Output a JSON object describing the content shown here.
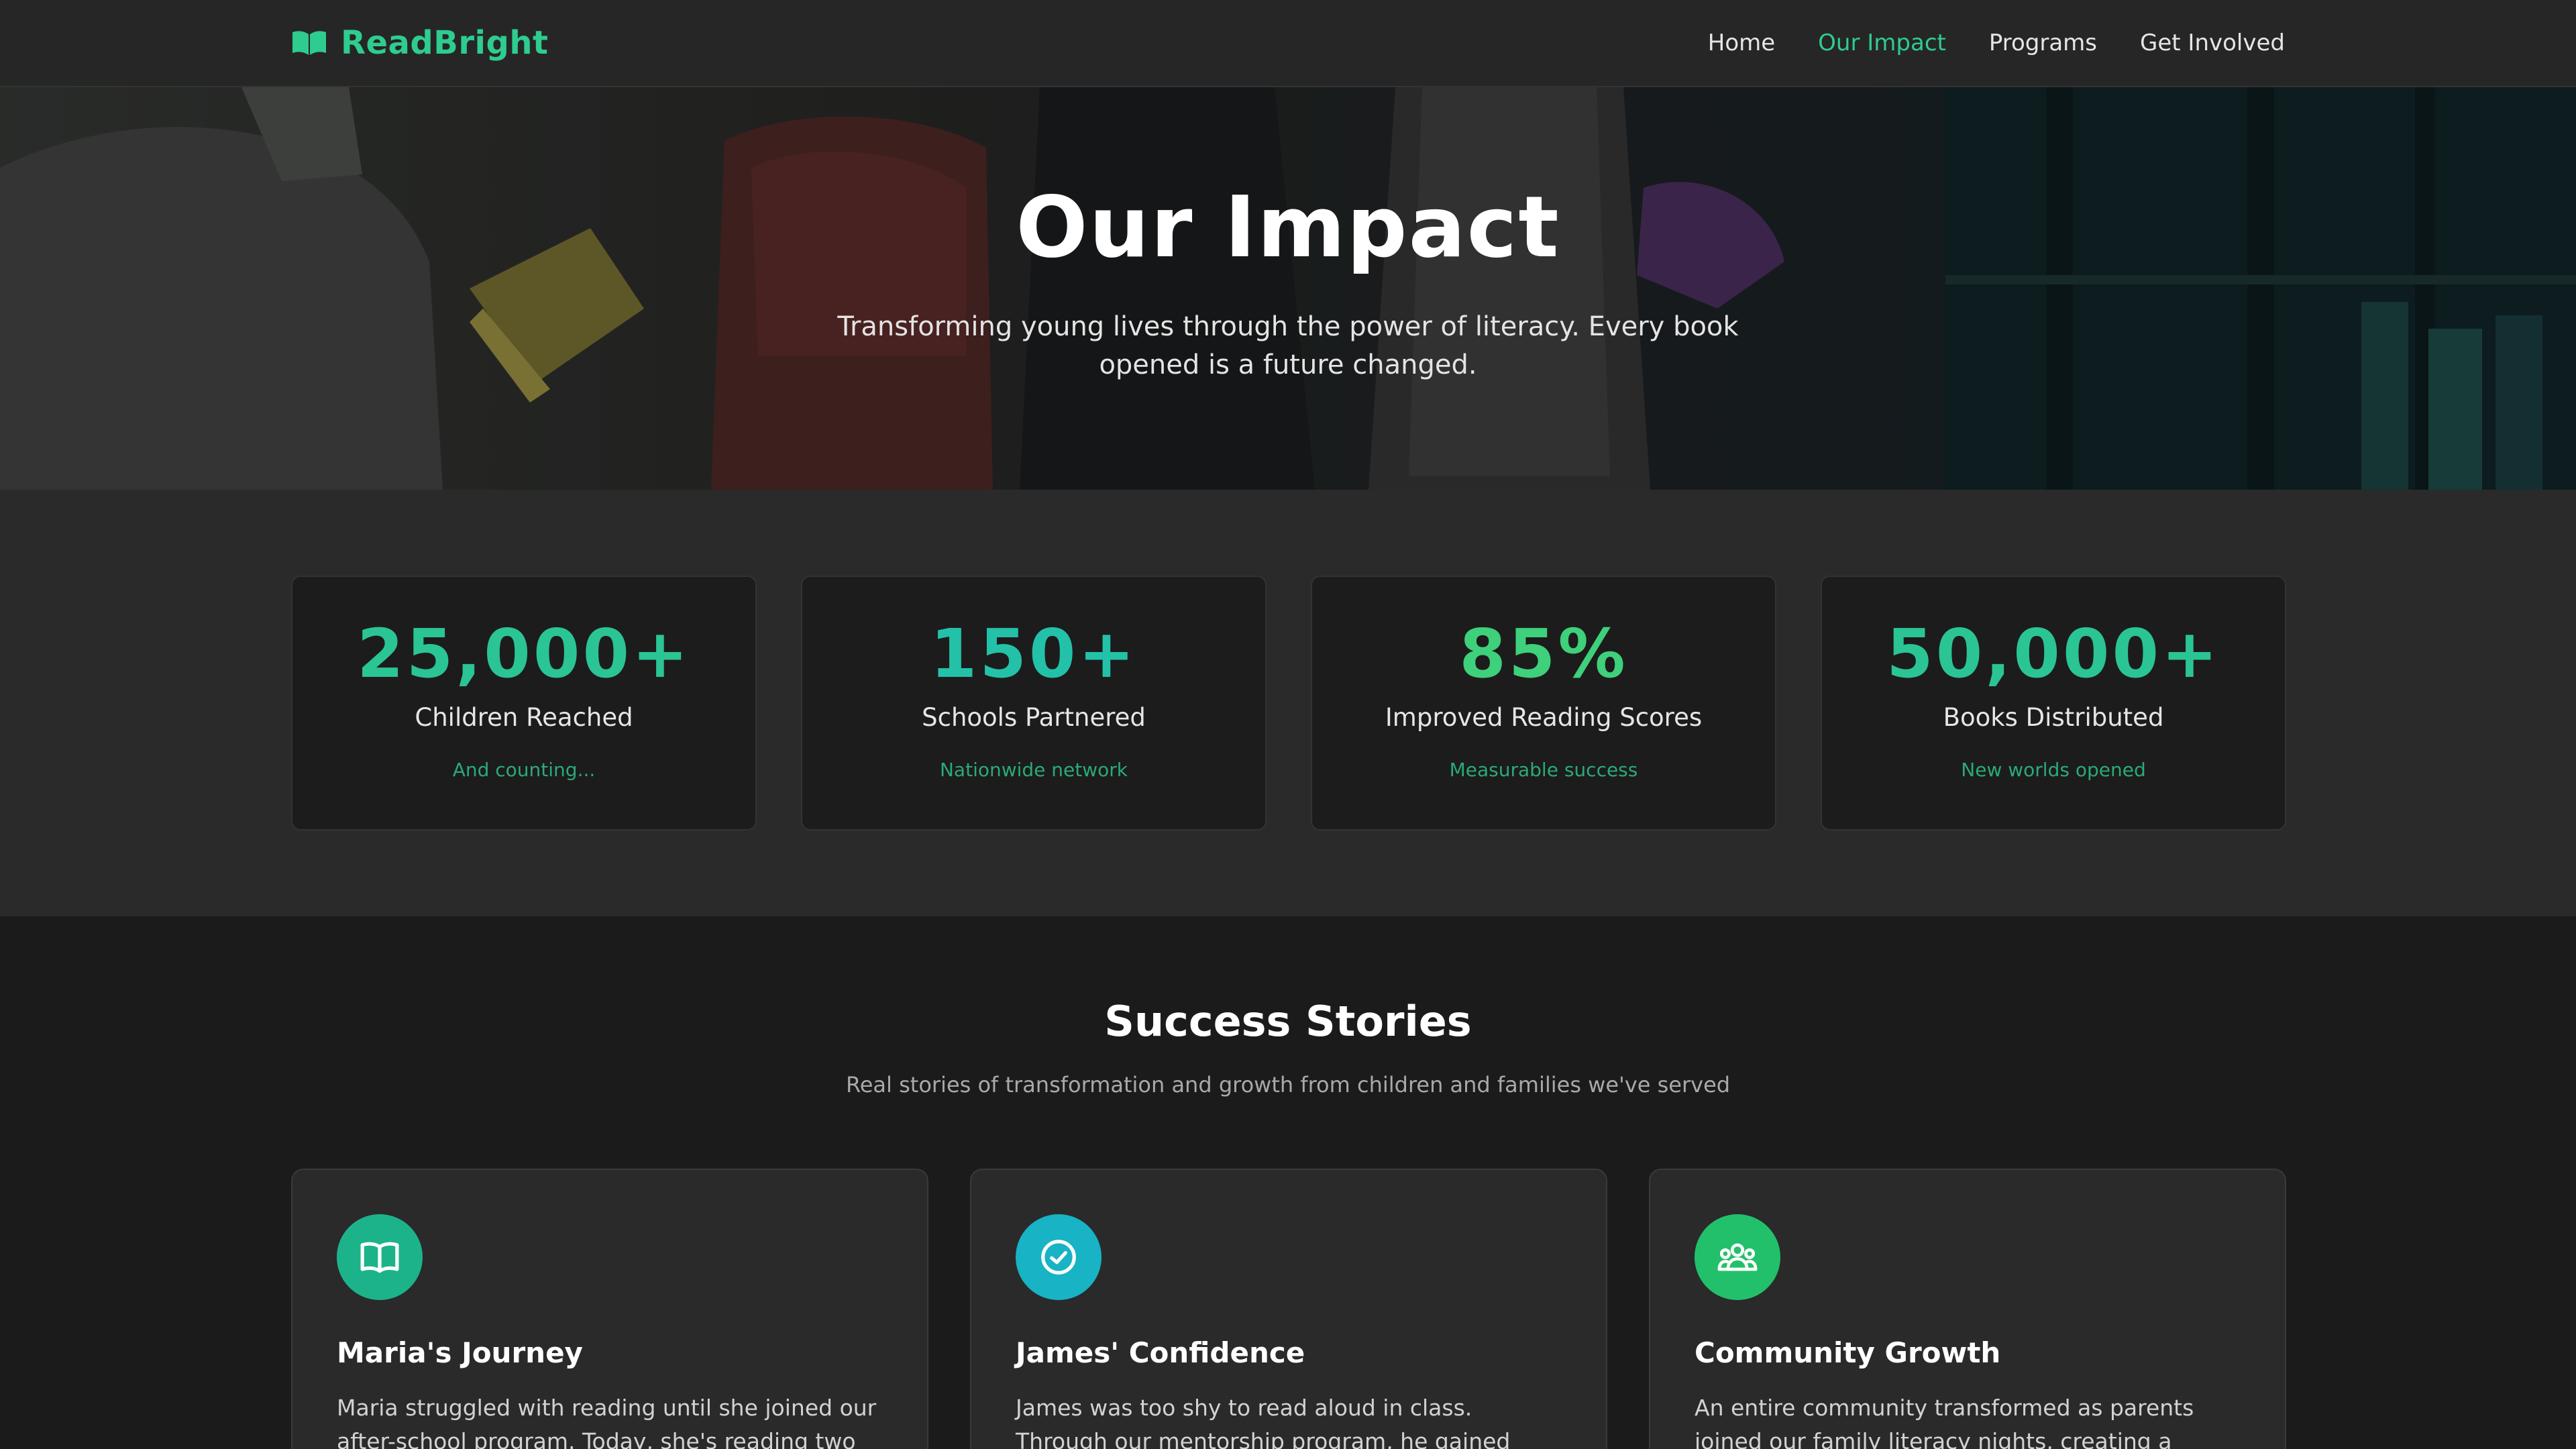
{
  "nav": {
    "brand": "ReadBright",
    "brand_icon": "open-book-icon",
    "links": [
      "Home",
      "Our Impact",
      "Programs",
      "Get Involved"
    ],
    "active": "Our Impact"
  },
  "hero": {
    "title": "Our Impact",
    "subtitle": "Transforming young lives through the power of literacy. Every book opened is a future changed."
  },
  "stats": [
    {
      "value": "25,000+",
      "label": "Children Reached",
      "note": "And counting...",
      "color": "#2bc495"
    },
    {
      "value": "150+",
      "label": "Schools Partnered",
      "note": "Nationwide network",
      "color": "#23c2a8"
    },
    {
      "value": "85%",
      "label": "Improved Reading Scores",
      "note": "Measurable success",
      "color": "#3ed07a"
    },
    {
      "value": "50,000+",
      "label": "Books Distributed",
      "note": "New worlds opened",
      "color": "#2bc495"
    }
  ],
  "stories": {
    "title": "Success Stories",
    "subtitle": "Real stories of transformation and growth from children and families we've served",
    "items": [
      {
        "icon": "open-book-icon",
        "icon_bg": "#1db38a",
        "title": "Maria's Journey",
        "text": "Maria struggled with reading until she joined our after-school program. Today, she's reading two"
      },
      {
        "icon": "check-circle-icon",
        "icon_bg": "#18b3c4",
        "title": "James' Confidence",
        "text": "James was too shy to read aloud in class. Through our mentorship program, he gained confidence"
      },
      {
        "icon": "community-icon",
        "icon_bg": "#22c06a",
        "title": "Community Growth",
        "text": "An entire community transformed as parents joined our family literacy nights, creating a culture"
      }
    ]
  }
}
